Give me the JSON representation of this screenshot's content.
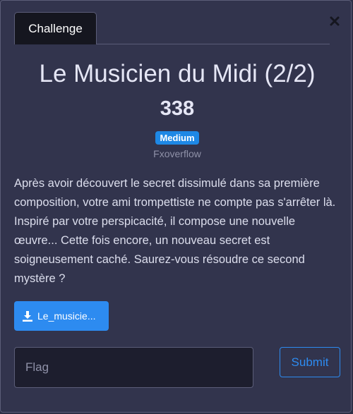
{
  "tabs": {
    "challenge_label": "Challenge"
  },
  "close_icon": "close-icon",
  "challenge": {
    "title": "Le Musicien du Midi (2/2)",
    "points": "338",
    "difficulty": "Medium",
    "author": "Fxoverflow",
    "description": "Après avoir découvert le secret dissimulé dans sa première composition, votre ami trompettiste ne compte pas s'arrêter là. Inspiré par votre perspicacité, il compose une nouvelle œuvre... Cette fois encore, un nouveau secret est soigneusement caché. Saurez-vous résoudre ce second mystère ?"
  },
  "download": {
    "icon": "download-icon",
    "label": "Le_musicie..."
  },
  "flag_form": {
    "placeholder": "Flag",
    "value": "",
    "submit_label": "Submit"
  },
  "colors": {
    "background": "#32344d",
    "accent": "#2d8bf0",
    "badge": "#1e88e5",
    "input_bg": "#1d1e2e"
  }
}
